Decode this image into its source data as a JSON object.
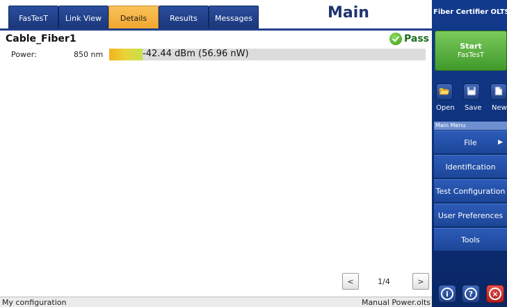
{
  "tabs": [
    {
      "label": "FasTesT",
      "active": false
    },
    {
      "label": "Link View",
      "active": false
    },
    {
      "label": "Details",
      "active": true
    },
    {
      "label": "Results",
      "active": false
    },
    {
      "label": "Messages",
      "active": false
    }
  ],
  "header": {
    "title": "Main"
  },
  "details": {
    "cable_name": "Cable_Fiber1",
    "status": "Pass",
    "power_label": "Power:",
    "wavelength": "850 nm",
    "power_value": "-42.44 dBm (56.96 nW)"
  },
  "pager": {
    "prev": "<",
    "page": "1/4",
    "next": ">"
  },
  "statusbar": {
    "left": "My configuration",
    "right": "Manual Power.olts"
  },
  "panel": {
    "title": "Fiber Certifier OLTS",
    "start_line1": "Start",
    "start_line2": "FasTesT",
    "file_buttons": [
      {
        "label": "Open",
        "icon": "folder-open-icon"
      },
      {
        "label": "Save",
        "icon": "floppy-save-icon"
      },
      {
        "label": "New",
        "icon": "new-document-icon"
      }
    ],
    "menu_header": "Main Menu",
    "menu_items": [
      {
        "label": "File",
        "has_arrow": true
      },
      {
        "label": "Identification"
      },
      {
        "label": "Test Configuration"
      },
      {
        "label": "User Preferences"
      },
      {
        "label": "Tools"
      }
    ],
    "bottom_icons": [
      "info-icon",
      "help-icon",
      "close-icon"
    ]
  },
  "colors": {
    "tab_blue": "#2b4e9e",
    "tab_active": "#f4b03f",
    "panel_blue": "#0d2f77",
    "start_green": "#4fae35",
    "pass_green": "#1d6e1d"
  }
}
